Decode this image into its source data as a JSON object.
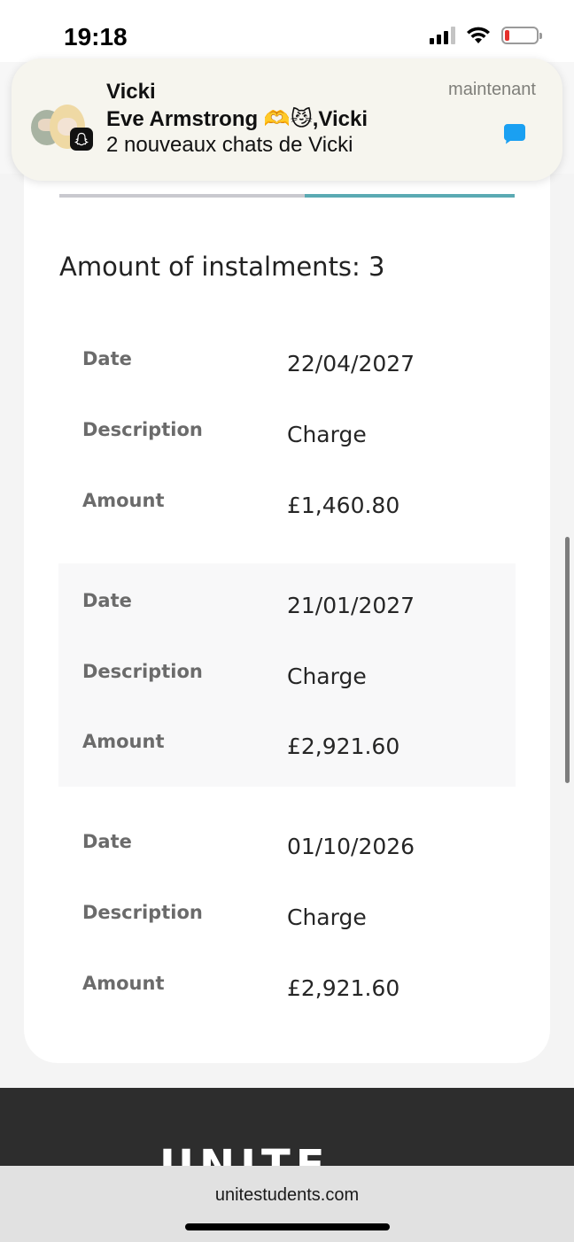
{
  "status_bar": {
    "time": "19:18",
    "battery_level": 0.15
  },
  "notification": {
    "title": "Vicki",
    "subtitle": "Eve Armstrong 🫶😼,Vicki",
    "body": "2 nouveaux chats de Vicki",
    "time": "maintenant",
    "accent_color": "#1aa0f2"
  },
  "instalments": {
    "heading": "Amount of instalments: 3",
    "labels": {
      "date": "Date",
      "description": "Description",
      "amount": "Amount"
    },
    "items": [
      {
        "date": "22/04/2027",
        "description": "Charge",
        "amount": "£1,460.80"
      },
      {
        "date": "21/01/2027",
        "description": "Charge",
        "amount": "£2,921.60"
      },
      {
        "date": "01/10/2026",
        "description": "Charge",
        "amount": "£2,921.60"
      }
    ]
  },
  "tabs": {
    "active_color": "#5aaab3"
  },
  "footer": {
    "logo_text": "UNITE"
  },
  "browser": {
    "url": "unitestudents.com"
  }
}
